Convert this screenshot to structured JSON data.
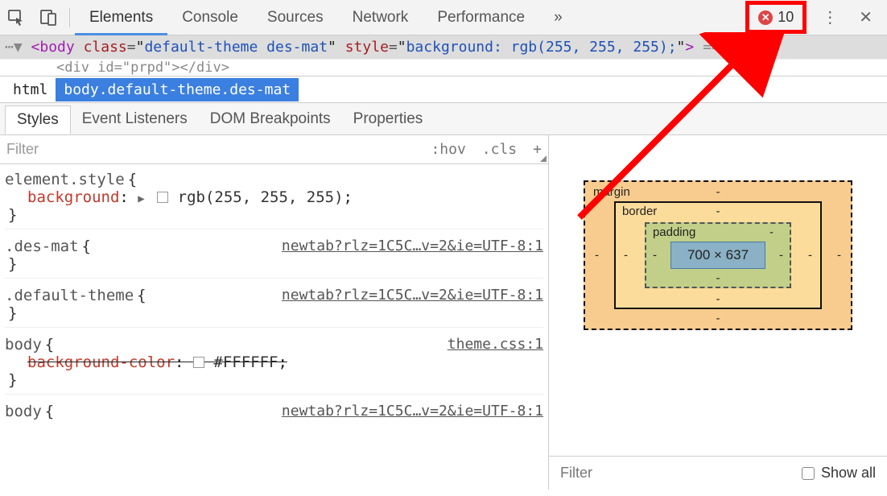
{
  "toolbar": {
    "tabs": [
      "Elements",
      "Console",
      "Sources",
      "Network",
      "Performance"
    ],
    "active_tab": 0,
    "overflow_glyph": "»",
    "error_count": "10"
  },
  "dom": {
    "gutter": "⋯▼",
    "tag_open": "<",
    "tag_name": "body",
    "attr_class": "class",
    "class_val": "default-theme des-mat",
    "attr_style": "style",
    "style_val": "background: rgb(255, 255, 255);",
    "tag_close": ">",
    "tail": " ==",
    "row2": "<div id=\"prpd\"></div>"
  },
  "breadcrumb": {
    "items": [
      "html",
      "body.default-theme.des-mat"
    ],
    "selected": 1
  },
  "subtabs": {
    "items": [
      "Styles",
      "Event Listeners",
      "DOM Breakpoints",
      "Properties"
    ],
    "active": 0
  },
  "styles_toolbar": {
    "filter_placeholder": "Filter",
    "hov": ":hov",
    "cls": ".cls",
    "add": "+"
  },
  "rules": [
    {
      "selector": "element.style",
      "brace_open": "{",
      "decl_prop": "background",
      "decl_sep": ":",
      "decl_disclosure": "▶",
      "decl_val": "rgb(255, 255, 255)",
      "semicolon": ";",
      "brace_close": "}",
      "source": ""
    },
    {
      "selector": ".des-mat",
      "brace_open": "{",
      "brace_close": "}",
      "source": "newtab?rlz=1C5C…v=2&ie=UTF-8:1"
    },
    {
      "selector": ".default-theme",
      "brace_open": "{",
      "brace_close": "}",
      "source": "newtab?rlz=1C5C…v=2&ie=UTF-8:1"
    },
    {
      "selector": "body",
      "brace_open": "{",
      "strike_prop": "background-color",
      "strike_sep": ":",
      "strike_val": "#FFFFFF",
      "semicolon": ";",
      "brace_close": "}",
      "source": "theme.css:1"
    },
    {
      "selector": "body",
      "brace_open": "{",
      "source": "newtab?rlz=1C5C…v=2&ie=UTF-8:1"
    }
  ],
  "boxmodel": {
    "margin_label": "margin",
    "border_label": "border",
    "padding_label": "padding",
    "dash": "-",
    "content": "700 × 637"
  },
  "sidebar_footer": {
    "filter_placeholder": "Filter",
    "show_all_label": "Show all"
  }
}
